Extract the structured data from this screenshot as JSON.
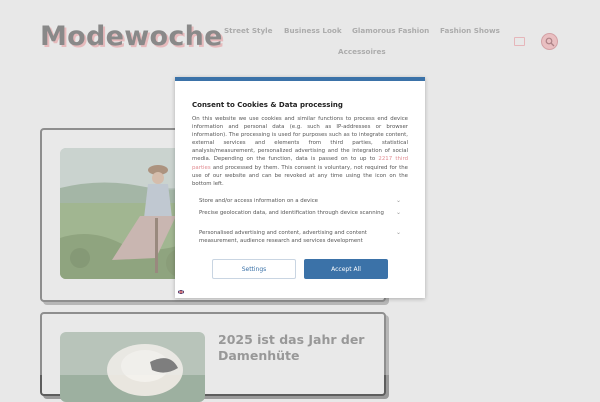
{
  "site": {
    "logo": "Modewoche",
    "nav": [
      "Street Style",
      "Business Look",
      "Glamorous Fashion",
      "Fashion Shows",
      "Accessoires"
    ],
    "icons": {
      "monitor": "monitor-icon",
      "search": "search-icon"
    }
  },
  "cards": [
    {
      "title": ""
    },
    {
      "title": "2025 ist das Jahr der Damenhüte"
    }
  ],
  "consent": {
    "title": "Consent to Cookies & Data processing",
    "body_1": "On this website we use cookies and similar functions to process end device information and personal data (e.g. such as IP-addresses or browser information). The processing is used for purposes such as to integrate content, external services and elements from third parties, statistical analysis/measurement, personalized advertising and the integration of social media. Depending on the function, data is passed on to up to ",
    "link": "2217 third parties",
    "body_2": " and processed by them. This consent is voluntary, not required for the use of our website and can be revoked at any time using the icon on the bottom left.",
    "purposes": [
      "Store and/or access information on a device",
      "Precise geolocation data, and identification through device scanning",
      "Personalised advertising and content, advertising and content measurement, audience research and services development"
    ],
    "settings_label": "Settings",
    "accept_label": "Accept All"
  },
  "colors": {
    "accent": "#3b72a8",
    "brand_pink": "#e3a0a4"
  }
}
